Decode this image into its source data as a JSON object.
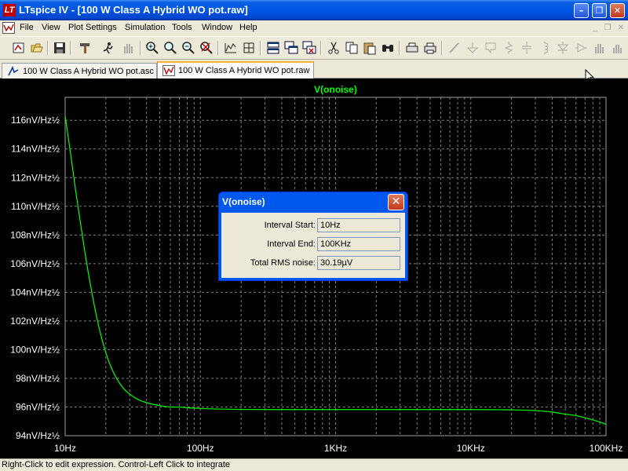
{
  "window": {
    "title": "LTspice IV - [100 W Class A Hybrid WO pot.raw]",
    "logo_text": "LT",
    "minimize_glyph": "–",
    "restore_glyph": "❐",
    "close_glyph": "✕"
  },
  "menu": {
    "items": [
      "File",
      "View",
      "Plot Settings",
      "Simulation",
      "Tools",
      "Window",
      "Help"
    ],
    "mdi_minimize": "_",
    "mdi_restore": "❐",
    "mdi_close": "✕"
  },
  "toolbar": {
    "icons": [
      "new-schematic-icon",
      "open-icon",
      "save-icon",
      "hammer-icon",
      "run-icon",
      "halt-hand-icon",
      "zoom-in-icon",
      "zoom-area-icon",
      "zoom-out-icon",
      "zoom-cancel-icon",
      "autorange-icon",
      "zoom-fit-icon",
      "tile-horizontal-icon",
      "cascade-icon",
      "close-all-icon",
      "cut-icon",
      "copy-icon",
      "paste-icon",
      "find-icon",
      "print-setup-icon",
      "print-icon",
      "wire-icon",
      "ground-icon",
      "label-icon",
      "resistor-icon",
      "capacitor-icon",
      "inductor-icon",
      "diode-icon",
      "component-icon",
      "move-hand-icon",
      "drag-hand-icon"
    ]
  },
  "tabs": [
    {
      "label": "100 W Class A Hybrid WO pot.asc",
      "icon": "schematic-icon",
      "active": false
    },
    {
      "label": "100 W Class A Hybrid WO pot.raw",
      "icon": "waveform-icon",
      "active": true
    }
  ],
  "plot": {
    "trace_name": "V(onoise)",
    "background": "#000000",
    "grid_color": "#7f7f7f",
    "trace_color": "#00ff00",
    "label_color": "#ffffff",
    "title_color": "#00ff00"
  },
  "chart_data": {
    "type": "line",
    "title": "V(onoise)",
    "x_scale": "log",
    "xlim": [
      10,
      100000
    ],
    "x_ticks": [
      {
        "value": 10,
        "label": "10Hz"
      },
      {
        "value": 100,
        "label": "100Hz"
      },
      {
        "value": 1000,
        "label": "1KHz"
      },
      {
        "value": 10000,
        "label": "10KHz"
      },
      {
        "value": 100000,
        "label": "100KHz"
      }
    ],
    "ylim": [
      94,
      117.6
    ],
    "y_unit": "nV/Hz½",
    "y_ticks": [
      {
        "value": 116,
        "label": "116nV/Hz½"
      },
      {
        "value": 114,
        "label": "114nV/Hz½"
      },
      {
        "value": 112,
        "label": "112nV/Hz½"
      },
      {
        "value": 110,
        "label": "110nV/Hz½"
      },
      {
        "value": 108,
        "label": "108nV/Hz½"
      },
      {
        "value": 106,
        "label": "106nV/Hz½"
      },
      {
        "value": 104,
        "label": "104nV/Hz½"
      },
      {
        "value": 102,
        "label": "102nV/Hz½"
      },
      {
        "value": 100,
        "label": "100nV/Hz½"
      },
      {
        "value": 98,
        "label": "98nV/Hz½"
      },
      {
        "value": 96,
        "label": "96nV/Hz½"
      },
      {
        "value": 94,
        "label": "94nV/Hz½"
      }
    ],
    "grid": true,
    "series": [
      {
        "name": "V(onoise)",
        "x": [
          10,
          11,
          12,
          13,
          14,
          15,
          17,
          19,
          21,
          24,
          27,
          30,
          35,
          40,
          50,
          60,
          70,
          80,
          100,
          150,
          200,
          500,
          1000,
          2000,
          5000,
          10000,
          20000,
          30000,
          40000,
          50000,
          60000,
          70000,
          80000,
          90000,
          100000
        ],
        "y": [
          116.3,
          113.6,
          111.0,
          108.8,
          106.8,
          105.1,
          102.4,
          100.5,
          99.2,
          98.0,
          97.3,
          96.9,
          96.5,
          96.3,
          96.1,
          96.0,
          96.0,
          95.95,
          95.9,
          95.85,
          95.83,
          95.82,
          95.82,
          95.82,
          95.82,
          95.82,
          95.8,
          95.75,
          95.65,
          95.5,
          95.4,
          95.25,
          95.1,
          94.95,
          94.8
        ]
      }
    ]
  },
  "dialog": {
    "title": "V(onoise)",
    "close_glyph": "✕",
    "fields": [
      {
        "label": "Interval Start:",
        "value": "10Hz"
      },
      {
        "label": "Interval End:",
        "value": "100KHz"
      },
      {
        "label": "Total RMS noise:",
        "value": "30.19µV"
      }
    ]
  },
  "status": {
    "text": "Right-Click to edit expression. Control-Left Click to integrate"
  }
}
